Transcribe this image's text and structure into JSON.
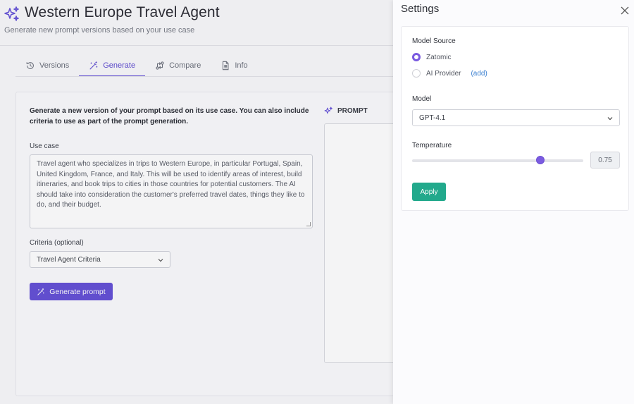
{
  "app": {
    "title": "Western Europe Travel Agent",
    "subtitle": "Generate new prompt versions based on your use case"
  },
  "tabs": [
    {
      "label": "Versions",
      "icon": "history-icon",
      "active": false
    },
    {
      "label": "Generate",
      "icon": "magic-wand-icon",
      "active": true
    },
    {
      "label": "Compare",
      "icon": "compare-icon",
      "active": false
    },
    {
      "label": "Info",
      "icon": "document-icon",
      "active": false
    }
  ],
  "generate": {
    "intro": "Generate a new version of your prompt based on its use case. You can also include criteria to use as part of the prompt generation.",
    "use_case_label": "Use case",
    "use_case_value": "Travel agent who specializes in trips to Western Europe, in particular Portugal, Spain, United Kingdom, France, and Italy. This will be used to identify areas of interest, build itineraries, and book trips to cities in those countries for potential customers. The AI should take into consideration the customer's preferred travel dates, things they like to do, and their budget.",
    "criteria_label": "Criteria (optional)",
    "criteria_value": "Travel Agent Criteria",
    "button_label": "Generate prompt",
    "prompt_header": "PROMPT"
  },
  "settings": {
    "title": "Settings",
    "model_source_label": "Model Source",
    "sources": [
      {
        "label": "Zatomic",
        "checked": true
      },
      {
        "label": "AI Provider",
        "checked": false,
        "link": "(add)"
      }
    ],
    "model_label": "Model",
    "model_value": "GPT-4.1",
    "temperature_label": "Temperature",
    "temperature_value": "0.75",
    "temperature_fraction": 0.75,
    "apply_label": "Apply"
  },
  "colors": {
    "accent": "#6552d8",
    "apply": "#22a98c",
    "radio": "#7a5ae0"
  }
}
